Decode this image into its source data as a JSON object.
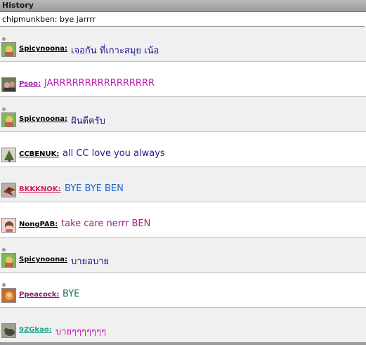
{
  "header": {
    "title": "History"
  },
  "current": {
    "text": "chipmunkben: bye jarrrr"
  },
  "messages": [
    {
      "user": "Spicynoona:",
      "text": "เจอกัน ที่เกาะสมุย เน้อ",
      "user_color": "#000000",
      "text_color": "#1a1a8c",
      "status_dot": true,
      "avatar": "green-avatar-icon"
    },
    {
      "user": "Psoo:",
      "text": "JARRRRRRRRRRRRRRRR",
      "user_color": "#9b1aa8",
      "text_color": "#c01bb5",
      "status_dot": false,
      "avatar": "photo-avatar-icon"
    },
    {
      "user": "Spicynoona:",
      "text": "ฝันดีครับ",
      "user_color": "#000000",
      "text_color": "#1a1a8c",
      "status_dot": true,
      "avatar": "green-avatar-icon"
    },
    {
      "user": "CCBENUK:",
      "text": "all CC love you always",
      "user_color": "#000000",
      "text_color": "#1a1a8c",
      "status_dot": false,
      "avatar": "tree-avatar-icon"
    },
    {
      "user": "BKKKNOK:",
      "text": "BYE BYE  BEN",
      "user_color": "#d41a5a",
      "text_color": "#1a66cc",
      "status_dot": false,
      "avatar": "bird-avatar-icon"
    },
    {
      "user": "NongPAB:",
      "text": "take care nerrr BEN",
      "user_color": "#000000",
      "text_color": "#a01a8c",
      "status_dot": false,
      "avatar": "girl-avatar-icon"
    },
    {
      "user": "Spicynoona:",
      "text": "บายอบาย",
      "user_color": "#000000",
      "text_color": "#1a1a8c",
      "status_dot": true,
      "avatar": "green-avatar-icon"
    },
    {
      "user": "Ppeacock:",
      "text": "BYE",
      "user_color": "#8c1a6e",
      "text_color": "#1a6e4a",
      "status_dot": true,
      "avatar": "peacock-avatar-icon"
    },
    {
      "user": "9ZGkao:",
      "text": "บายๆๆๆๆๆๆๆ",
      "user_color": "#1aa88c",
      "text_color": "#c01bb5",
      "status_dot": false,
      "avatar": "cat-avatar-icon"
    }
  ]
}
